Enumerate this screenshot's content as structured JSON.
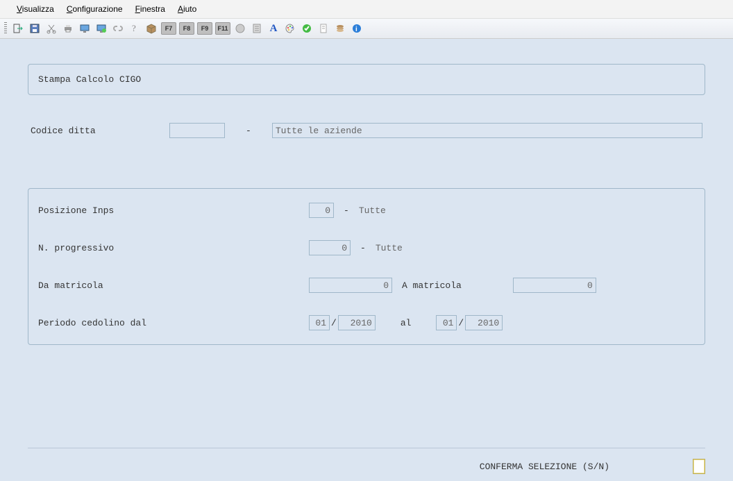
{
  "menu": {
    "visualizza": "Visualizza",
    "configurazione": "Configurazione",
    "finestra": "Finestra",
    "aiuto": "Aiuto"
  },
  "toolbar": {
    "fkeys": [
      "F7",
      "F8",
      "F9",
      "F11"
    ]
  },
  "panel_title": "Stampa Calcolo CIGO",
  "codice_ditta": {
    "label": "Codice ditta",
    "value": "",
    "dash": "-",
    "desc": "Tutte le aziende"
  },
  "posizione_inps": {
    "label": "Posizione Inps",
    "value": "0",
    "dash": "-",
    "desc": "Tutte"
  },
  "n_progressivo": {
    "label": "N. progressivo",
    "value": "0",
    "dash": "-",
    "desc": "Tutte"
  },
  "matricola": {
    "label_da": "Da matricola",
    "value_da": "0",
    "label_a": "A matricola",
    "value_a": "0"
  },
  "periodo": {
    "label": "Periodo cedolino dal",
    "mm1": "01",
    "slash1": "/",
    "yyyy1": "2010",
    "al": "al",
    "mm2": "01",
    "slash2": "/",
    "yyyy2": "2010"
  },
  "footer": {
    "prompt": "CONFERMA SELEZIONE (S/N)",
    "value": ""
  }
}
